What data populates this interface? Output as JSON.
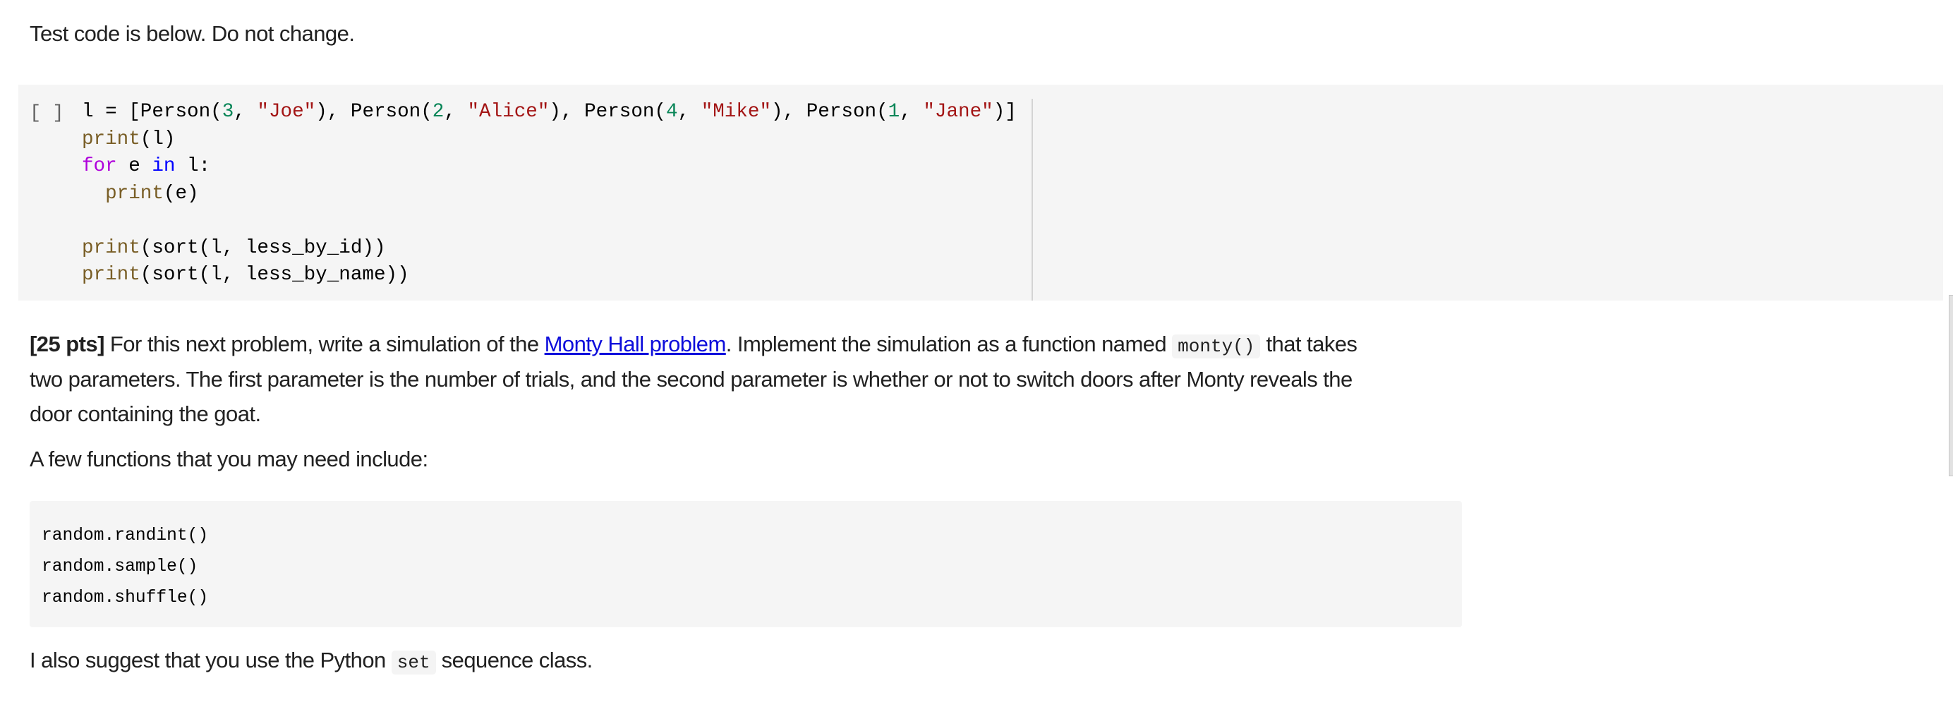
{
  "intro_text": "Test code is below. Do not change.",
  "code_cell": {
    "run_indicator": "[ ]",
    "lines": [
      [
        {
          "t": "plain",
          "v": "l = [Person("
        },
        {
          "t": "num",
          "v": "3"
        },
        {
          "t": "plain",
          "v": ", "
        },
        {
          "t": "str",
          "v": "\"Joe\""
        },
        {
          "t": "plain",
          "v": "), Person("
        },
        {
          "t": "num",
          "v": "2"
        },
        {
          "t": "plain",
          "v": ", "
        },
        {
          "t": "str",
          "v": "\"Alice\""
        },
        {
          "t": "plain",
          "v": "), Person("
        },
        {
          "t": "num",
          "v": "4"
        },
        {
          "t": "plain",
          "v": ", "
        },
        {
          "t": "str",
          "v": "\"Mike\""
        },
        {
          "t": "plain",
          "v": "), Person("
        },
        {
          "t": "num",
          "v": "1"
        },
        {
          "t": "plain",
          "v": ", "
        },
        {
          "t": "str",
          "v": "\"Jane\""
        },
        {
          "t": "plain",
          "v": ")]"
        }
      ],
      [
        {
          "t": "func",
          "v": "print"
        },
        {
          "t": "plain",
          "v": "(l)"
        }
      ],
      [
        {
          "t": "kw",
          "v": "for"
        },
        {
          "t": "plain",
          "v": " e "
        },
        {
          "t": "kw2",
          "v": "in"
        },
        {
          "t": "plain",
          "v": " l:"
        }
      ],
      [
        {
          "t": "plain",
          "v": "  "
        },
        {
          "t": "func",
          "v": "print"
        },
        {
          "t": "plain",
          "v": "(e)"
        }
      ],
      [],
      [
        {
          "t": "func",
          "v": "print"
        },
        {
          "t": "plain",
          "v": "(sort(l, less_by_id))"
        }
      ],
      [
        {
          "t": "func",
          "v": "print"
        },
        {
          "t": "plain",
          "v": "(sort(l, less_by_name))"
        }
      ]
    ]
  },
  "problem": {
    "points_label": "[25 pts]",
    "line1_before_link": " For this next problem, write a simulation of the ",
    "link_text": "Monty Hall problem",
    "line1_after_link": ". Implement the simulation as a function named ",
    "function_name": "monty()",
    "line1_end": " that takes",
    "line2": "two parameters. The first parameter is the number of trials, and the second parameter is whether or not to switch doors after Monty reveals the",
    "line3": "door containing the goat."
  },
  "functions_intro": "A few functions that you may need include:",
  "functions_list": [
    "random.randint()",
    "random.sample()",
    "random.shuffle()"
  ],
  "set_suggestion": {
    "before": "I also suggest that you use the Python ",
    "code": "set",
    "after": " sequence class."
  },
  "colors": {
    "text": "#212121",
    "link": "#0d0ddb",
    "code_background": "#f5f5f5",
    "token_function": "#795e26",
    "token_number": "#098658",
    "token_string": "#a31515",
    "token_keyword": "#af00db",
    "token_keyword_in": "#0000ff"
  }
}
